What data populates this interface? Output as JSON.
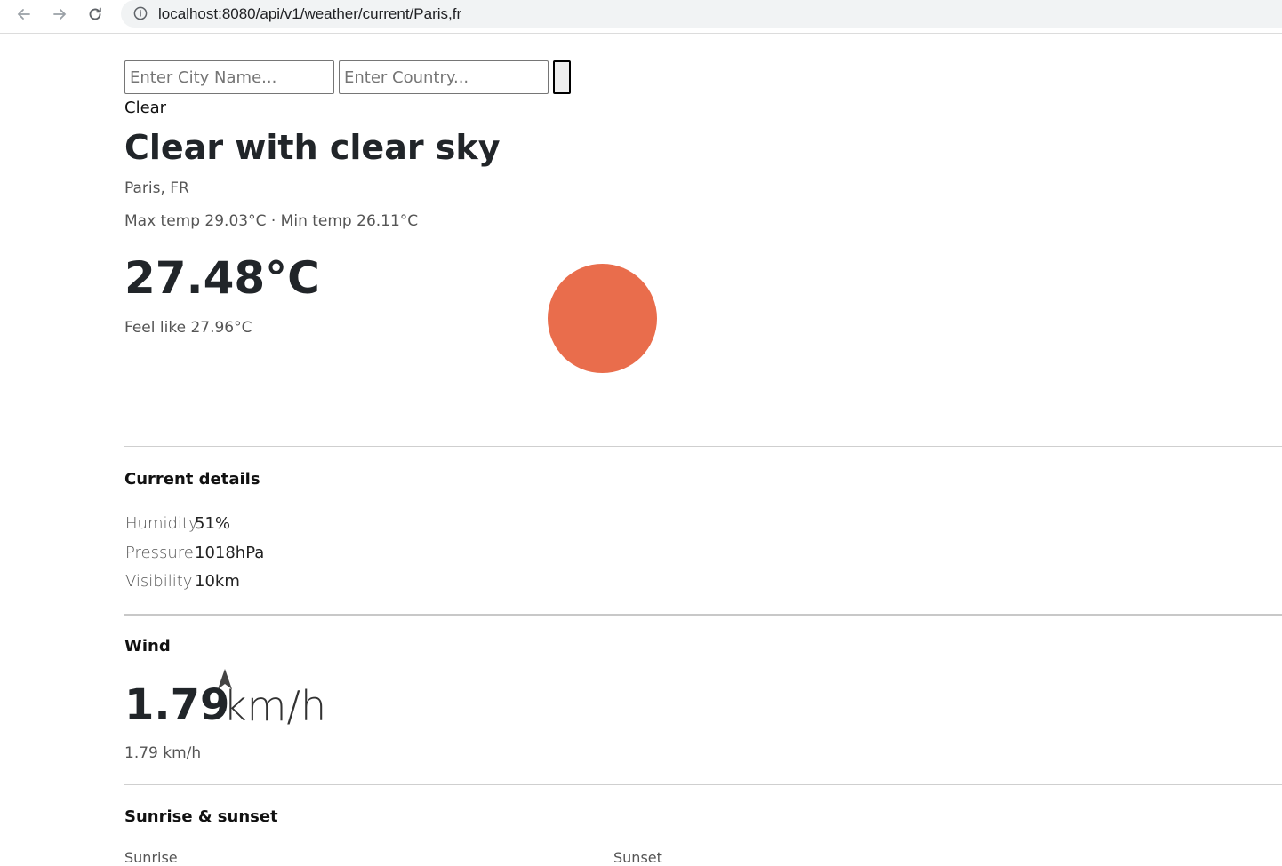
{
  "browser": {
    "url": "localhost:8080/api/v1/weather/current/Paris,fr"
  },
  "search": {
    "city_placeholder": "Enter City Name...",
    "country_placeholder": "Enter Country..."
  },
  "weather": {
    "condition": "Clear",
    "title": "Clear with clear sky",
    "location": "Paris, FR",
    "minmax": "Max temp 29.03°C · Min temp 26.11°C",
    "temperature": "27.48°C",
    "feels_like": "Feel like 27.96°C",
    "sun_color": "#E96D4C"
  },
  "current_details": {
    "heading": "Current details",
    "rows": [
      {
        "label": "Humidity",
        "value": "51%"
      },
      {
        "label": "Pressure",
        "value": "1018hPa"
      },
      {
        "label": "Visibility",
        "value": "10km"
      }
    ]
  },
  "wind": {
    "heading": "Wind",
    "speed": "1.79",
    "unit": "km/h",
    "sub": "1.79 km/h"
  },
  "sun": {
    "heading": "Sunrise & sunset",
    "sunrise_label": "Sunrise",
    "sunset_label": "Sunset"
  }
}
